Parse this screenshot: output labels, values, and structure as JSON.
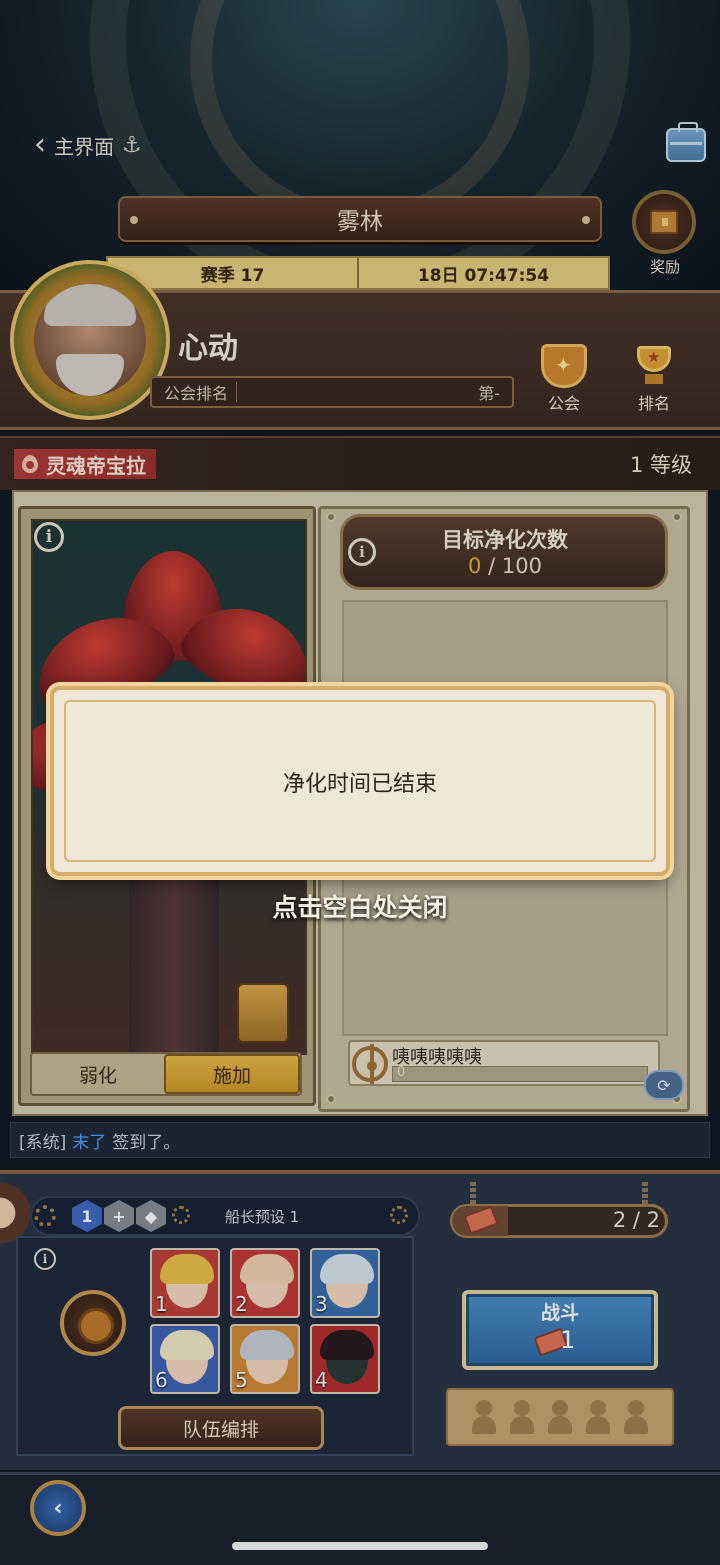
{
  "nav": {
    "back_label": "主界面"
  },
  "region": {
    "name": "雾林"
  },
  "reward": {
    "label": "奖励"
  },
  "season": {
    "label": "赛季 17",
    "timer": "18日 07:47:54"
  },
  "player": {
    "name": "心动",
    "guild_rank_label": "公会排名",
    "guild_rank_value": "第-"
  },
  "side_buttons": {
    "guild": "公会",
    "ranking": "排名"
  },
  "boss": {
    "name": "灵魂帝宝拉",
    "level": "1 等级"
  },
  "debuff_tabs": {
    "weaken": "弱化",
    "apply": "施加"
  },
  "target": {
    "title": "目标净化次数",
    "current": "0",
    "total": "/ 100"
  },
  "member": {
    "name": "咦咦咦咦咦",
    "progress": "0"
  },
  "modal": {
    "message": "净化时间已结束",
    "close_hint": "点击空白处关闭"
  },
  "chat": {
    "channel": "[系统]",
    "player": "末了",
    "message": "签到了。"
  },
  "team": {
    "preset_number": "1",
    "preset_name": "船长预设 1",
    "arrange_label": "队伍编排",
    "heroes": [
      {
        "slot": "1",
        "bg": "#c0413a",
        "hair": "#e9c14b"
      },
      {
        "slot": "2",
        "bg": "#c23a38",
        "hair": "#f0d2b0"
      },
      {
        "slot": "3",
        "bg": "#3a6fb0",
        "hair": "#d8e4f0"
      },
      {
        "slot": "6",
        "bg": "#3f63b5",
        "hair": "#f2e6c8"
      },
      {
        "slot": "5",
        "bg": "#d28a3a",
        "hair": "#c9cdd8"
      },
      {
        "slot": "4",
        "bg": "#b3302e",
        "hair": "#2a1a22"
      }
    ]
  },
  "stamina": {
    "value": "2 / 2",
    "fill_fraction": 0.2
  },
  "battle": {
    "label": "战斗",
    "cost": "1"
  },
  "colors": {
    "accent_gold": "#e2b13f",
    "battle_blue": "#2f6aa5",
    "boss_red": "#b23c3a"
  },
  "icons": [
    "chevron-left-icon",
    "anchor-icon",
    "toolbox-icon",
    "chest-icon",
    "guild-shield-icon",
    "trophy-icon",
    "flame-icon",
    "info-icon",
    "wheel-icon",
    "refresh-icon",
    "gear-icon",
    "plus-icon",
    "drop-icon",
    "ticket-icon",
    "person-icon"
  ]
}
